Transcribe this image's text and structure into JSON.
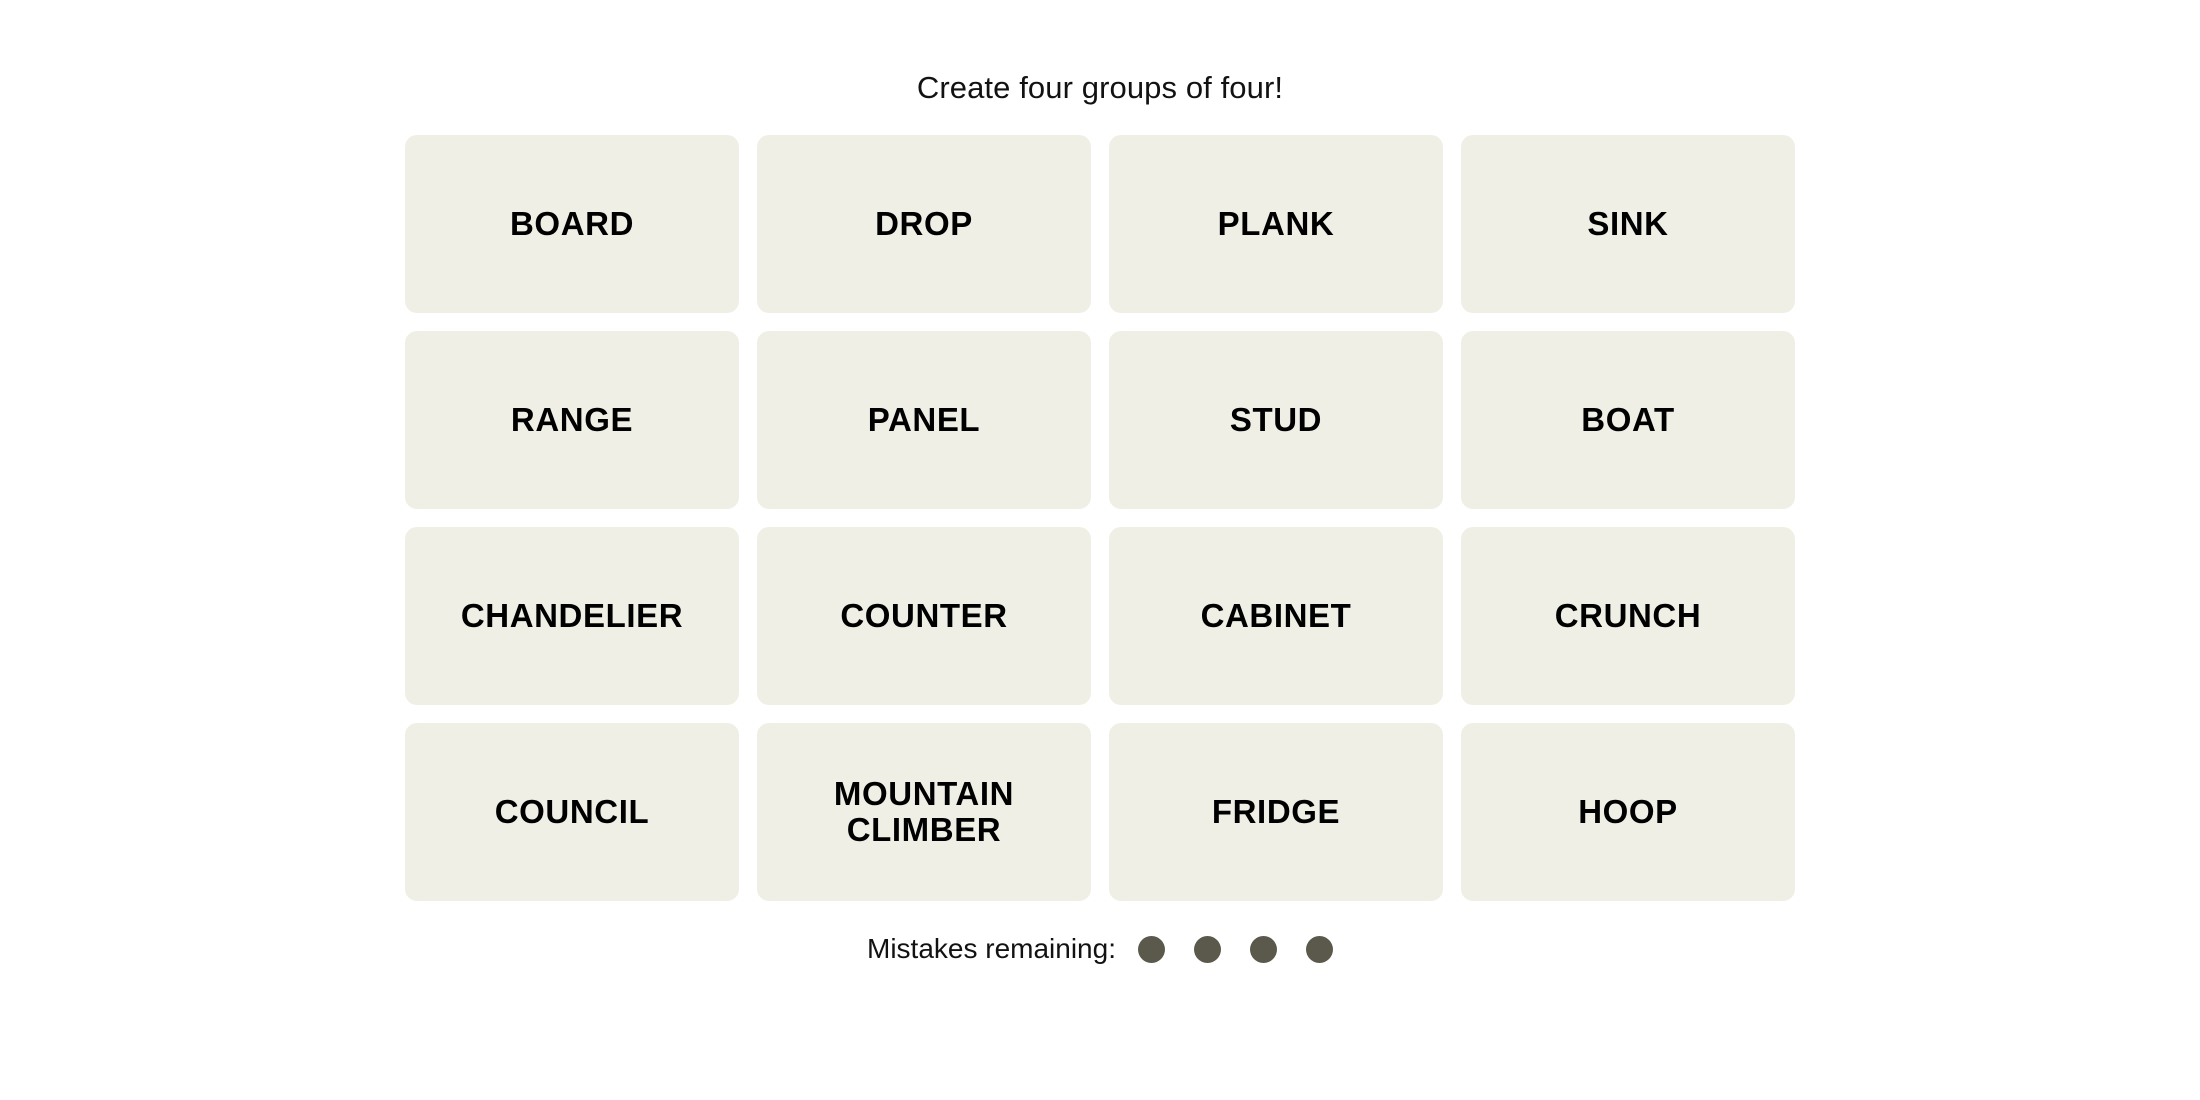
{
  "game": {
    "instruction": "Create four groups of four!",
    "tile_background_color": "#EFEFE6",
    "tile_text_color": "#000000",
    "page_background_color": "#FFFFFF",
    "mistake_dot_color": "#5A594B"
  },
  "tiles": [
    {
      "label": "BOARD"
    },
    {
      "label": "DROP"
    },
    {
      "label": "PLANK"
    },
    {
      "label": "SINK"
    },
    {
      "label": "RANGE"
    },
    {
      "label": "PANEL"
    },
    {
      "label": "STUD"
    },
    {
      "label": "BOAT"
    },
    {
      "label": "CHANDELIER"
    },
    {
      "label": "COUNTER"
    },
    {
      "label": "CABINET"
    },
    {
      "label": "CRUNCH"
    },
    {
      "label": "COUNCIL"
    },
    {
      "label": "MOUNTAIN\nCLIMBER"
    },
    {
      "label": "FRIDGE"
    },
    {
      "label": "HOOP"
    }
  ],
  "mistakes": {
    "label": "Mistakes remaining:",
    "remaining": 4,
    "dots": [
      {
        "state": "filled"
      },
      {
        "state": "filled"
      },
      {
        "state": "filled"
      },
      {
        "state": "filled"
      }
    ]
  }
}
